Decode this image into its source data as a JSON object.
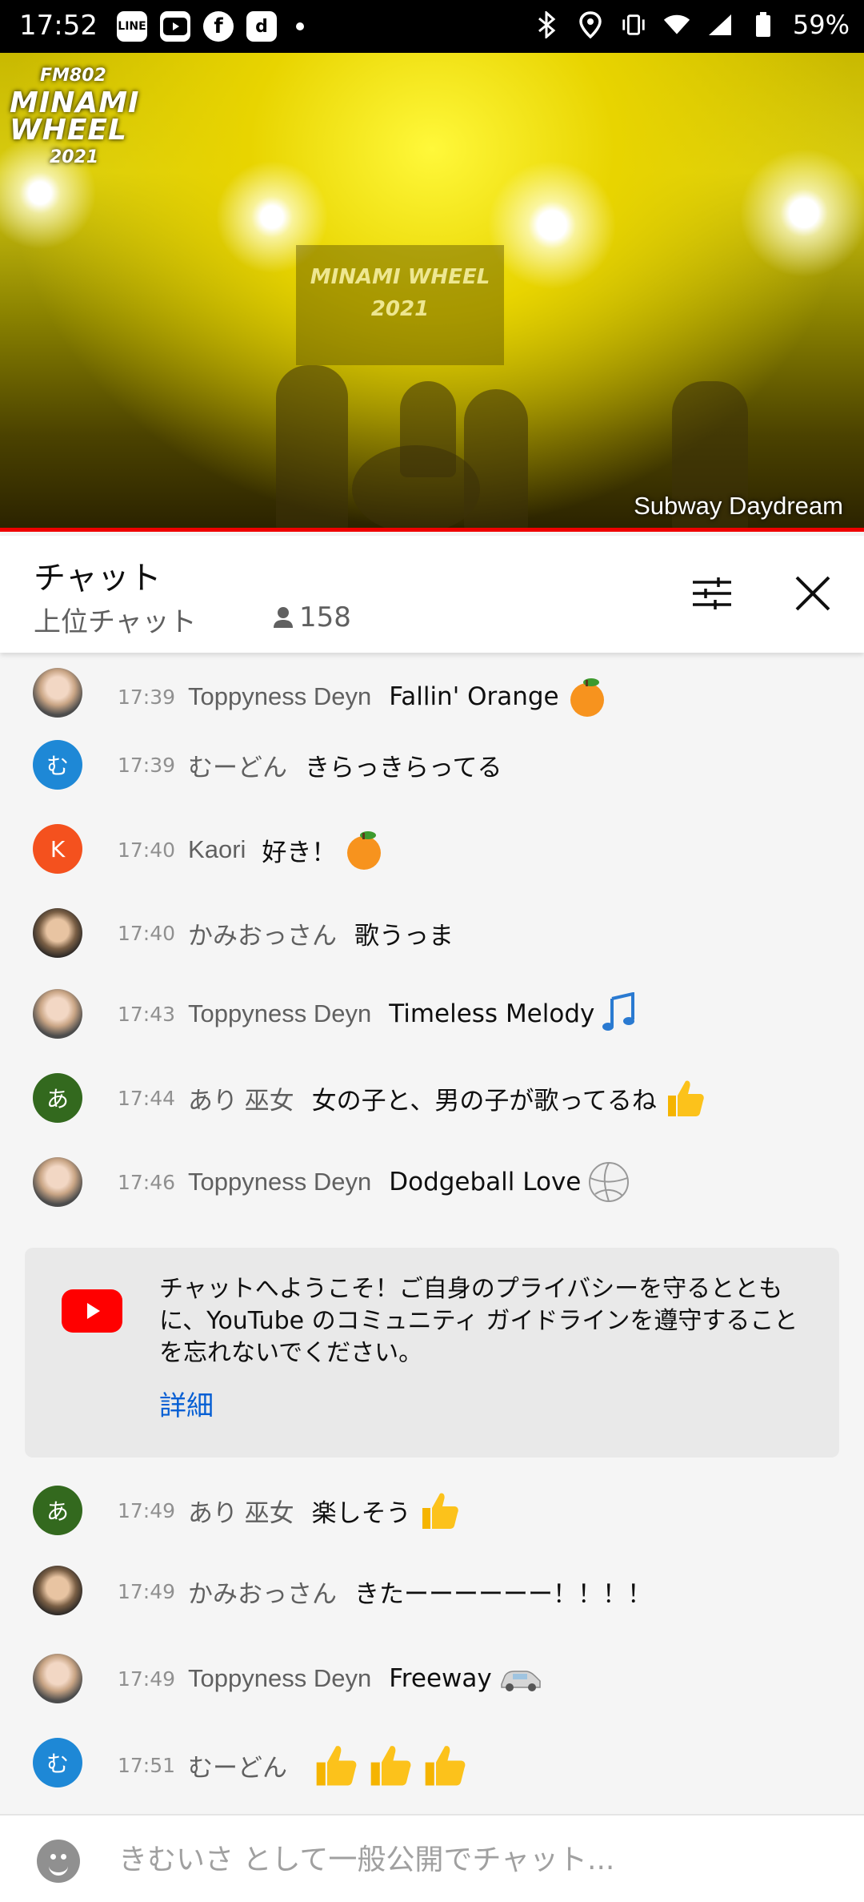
{
  "status_bar": {
    "time": "17:52",
    "app_icons": [
      "LINE",
      "YouTube",
      "Facebook",
      "d"
    ],
    "battery": "59%"
  },
  "video": {
    "logo": {
      "line1": "FM802",
      "line2": "MINAMI",
      "line3": "WHEEL",
      "year": "2021"
    },
    "stage_sign": "MINAMI WHEEL 2021",
    "caption": "Subway Daydream",
    "progress_color": "#ee0000"
  },
  "chat_header": {
    "title": "チャット",
    "mode": "上位チャット",
    "viewers": "158"
  },
  "messages": [
    {
      "time": "17:39",
      "author": "Toppyness Deyn",
      "text": "Fallin' Orange",
      "emoji": "tangerine",
      "avatar": "face"
    },
    {
      "time": "17:39",
      "author": "むーどん",
      "text": "きらっきらってる",
      "avatar_letter": "む",
      "avatar_color": "#1e88d6"
    },
    {
      "time": "17:40",
      "author": "Kaori",
      "text": "好き！",
      "emoji": "tangerine",
      "avatar_letter": "K",
      "avatar_color": "#f4511e"
    },
    {
      "time": "17:40",
      "author": "かみおっさん",
      "text": "歌うっま",
      "avatar": "face2"
    },
    {
      "time": "17:43",
      "author": "Toppyness Deyn",
      "text": "Timeless Melody",
      "emoji": "musical-notes",
      "avatar": "face"
    },
    {
      "time": "17:44",
      "author": "あり 巫女",
      "text": "女の子と、男の子が歌ってるね",
      "emoji": "thumbs-up",
      "avatar_letter": "あ",
      "avatar_color": "#33691e"
    },
    {
      "time": "17:46",
      "author": "Toppyness Deyn",
      "text": "Dodgeball Love",
      "emoji": "volleyball",
      "avatar": "face"
    },
    {
      "time": "17:49",
      "author": "あり 巫女",
      "text": "楽しそう",
      "emoji": "thumbs-up",
      "avatar_letter": "あ",
      "avatar_color": "#33691e"
    },
    {
      "time": "17:49",
      "author": "かみおっさん",
      "text": "きたーーーーーー！！！！",
      "avatar": "face2"
    },
    {
      "time": "17:49",
      "author": "Toppyness Deyn",
      "text": "Freeway",
      "emoji": "car",
      "avatar": "face"
    },
    {
      "time": "17:51",
      "author": "むーどん",
      "text": "",
      "emoji": "thumbs-up-x3",
      "avatar_letter": "む",
      "avatar_color": "#1e88d6"
    }
  ],
  "welcome": {
    "text": "チャットへようこそ！ご自身のプライバシーを守るとともに、YouTube のコミュニティ ガイドラインを遵守することを忘れないでください。",
    "link": "詳細"
  },
  "input": {
    "placeholder": "きむいさ として一般公開でチャット..."
  }
}
